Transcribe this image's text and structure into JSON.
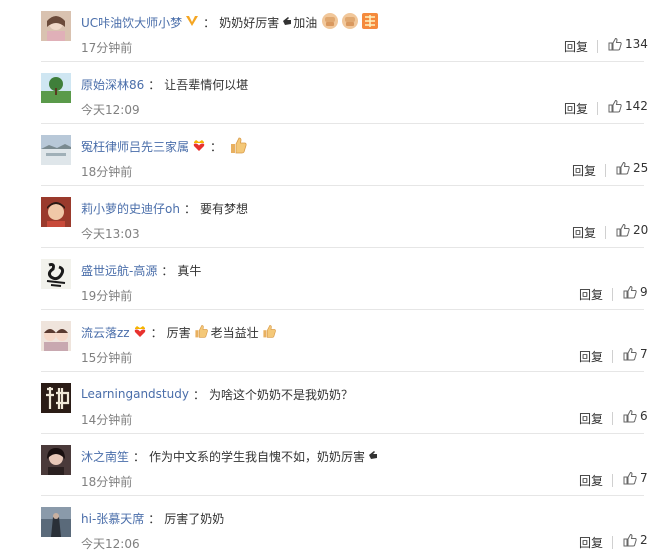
{
  "comments": [
    {
      "user": "UC咔油饮大师小梦",
      "badge": "vip-v",
      "text": "奶奶好厉害",
      "text_after_icon": "加油",
      "icons": [
        "pointing-hand-icon",
        "fist-icon",
        "fist-icon",
        "fighting-icon"
      ],
      "time": "17分钟前",
      "reply_label": "回复",
      "likes": "134",
      "avatar_color": "#c9a88e"
    },
    {
      "user": "原始深林86",
      "text": "让吾辈情何以堪",
      "time": "今天12:09",
      "reply_label": "回复",
      "likes": "142",
      "avatar_color": "#6aa86a"
    },
    {
      "user": "冤枉律师吕先三家属",
      "badge": "crown-heart",
      "text": "",
      "icons": [
        "thumbs-up-icon"
      ],
      "time": "18分钟前",
      "reply_label": "回复",
      "likes": "25",
      "avatar_color": "#8aa4c0"
    },
    {
      "user": "莉小萝的史迪仔oh",
      "text": "要有梦想",
      "time": "今天13:03",
      "reply_label": "回复",
      "likes": "20",
      "avatar_color": "#a04a3c"
    },
    {
      "user": "盛世远航-高源",
      "text": "真牛",
      "time": "19分钟前",
      "reply_label": "回复",
      "likes": "9",
      "avatar_color": "#e8e8e0"
    },
    {
      "user": "流云落zz",
      "badge": "crown-heart",
      "text": "厉害",
      "text_after_icon": "老当益壮",
      "icons": [
        "thumbs-up-icon",
        "thumbs-up-icon"
      ],
      "time": "15分钟前",
      "reply_label": "回复",
      "likes": "7",
      "avatar_color": "#d8c8c0"
    },
    {
      "user": "Learningandstudy",
      "text": "为啥这个奶奶不是我奶奶？",
      "time": "14分钟前",
      "reply_label": "回复",
      "likes": "6",
      "avatar_color": "#3a2a20"
    },
    {
      "user": "沐之南笙",
      "text": "作为中文系的学生我自愧不如，奶奶厉害",
      "icons": [
        "pointing-hand-icon"
      ],
      "time": "18分钟前",
      "reply_label": "回复",
      "likes": "7",
      "avatar_color": "#5a4a48"
    },
    {
      "user": "hi-张慕天席",
      "text": "厉害了奶奶",
      "time": "今天12:06",
      "reply_label": "回复",
      "likes": "2",
      "avatar_color": "#4a5a6a"
    }
  ],
  "colors": {
    "username": "#4a6eaa",
    "badge_orange": "#f5a623",
    "time": "#808080"
  }
}
